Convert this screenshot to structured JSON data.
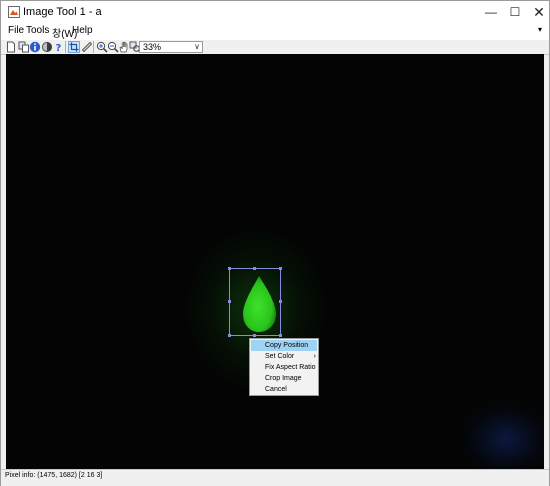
{
  "window": {
    "title": "Image Tool 1 - a",
    "minimize_glyph": "—",
    "maximize_glyph": "☐",
    "close_glyph": "✕"
  },
  "menu": {
    "file": "File",
    "tools": "Tools",
    "window": "창(W)",
    "help": "Help",
    "overflow_glyph": "▾"
  },
  "toolbar": {
    "icons": [
      "new-icon",
      "copy-icon",
      "info-icon",
      "adjust-contrast-icon",
      "help-icon",
      "crop-icon",
      "ruler-icon",
      "zoom-in-icon",
      "zoom-out-icon",
      "pan-hand-icon",
      "pixel-region-icon"
    ],
    "zoom_level": "33%",
    "zoom_dropdown_glyph": "∨"
  },
  "context_menu": {
    "items": [
      "Copy Position",
      "Set Color",
      "Fix Aspect Ratio",
      "Crop Image",
      "Cancel"
    ],
    "highlighted": "Copy Position",
    "submenu_glyph": "›"
  },
  "status": {
    "pixel_info": "Pixel info: (1475, 1682)  [2 16 3]"
  },
  "colors": {
    "roi_border": "#8a8ae0",
    "highlight": "#9fd3f5",
    "image_background": "#030403",
    "drop_green": "#29c41b"
  }
}
